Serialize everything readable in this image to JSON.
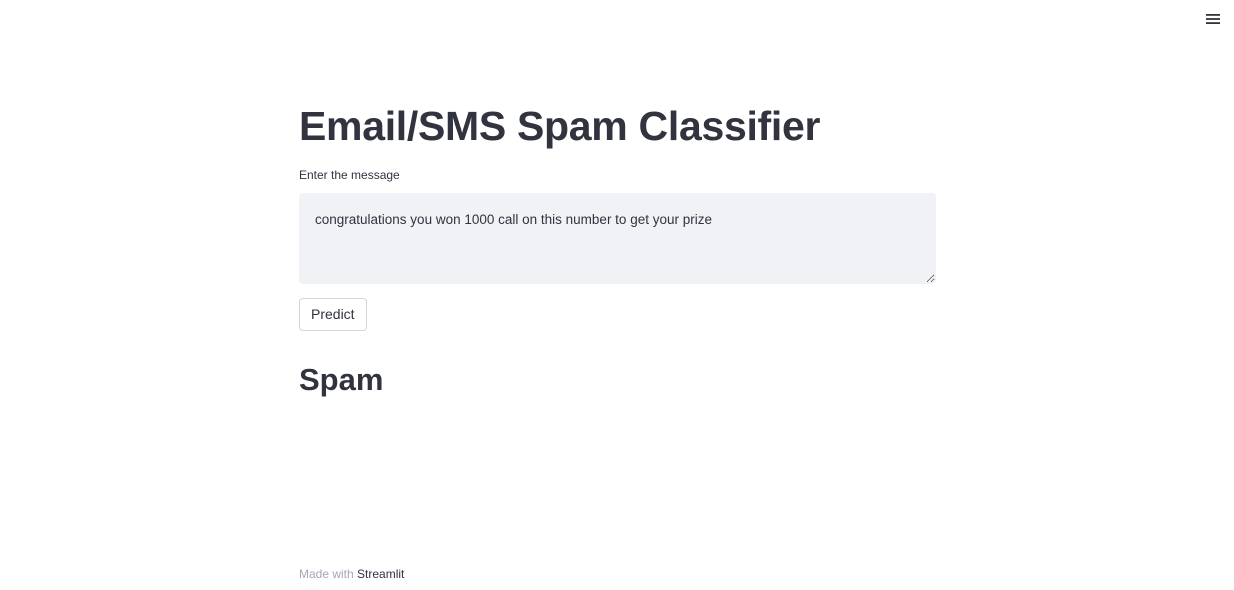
{
  "header": {
    "menu_icon": "hamburger-menu-icon"
  },
  "main": {
    "title": "Email/SMS Spam Classifier",
    "input_label": "Enter the message",
    "input_value": "congratulations you won 1000 call on this number to get your prize",
    "predict_label": "Predict",
    "result_text": "Spam"
  },
  "footer": {
    "prefix": "Made with",
    "link_text": "Streamlit"
  },
  "colors": {
    "text": "#31333f",
    "input_bg": "#f0f2f6",
    "button_border": "#d6d6d9",
    "footer_muted": "#a3a8b4"
  }
}
